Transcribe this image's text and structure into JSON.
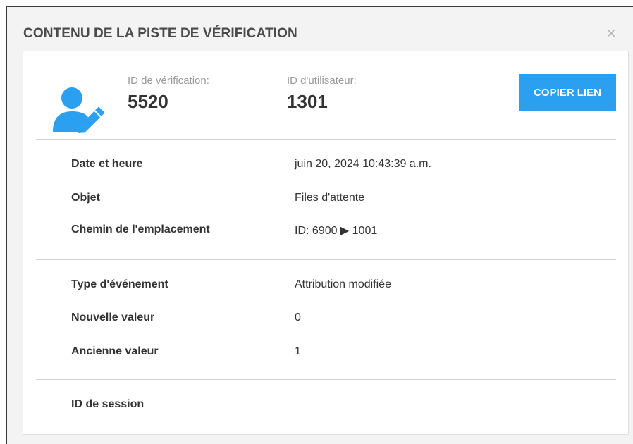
{
  "dialog": {
    "title": "CONTENU DE LA PISTE DE VÉRIFICATION",
    "close_glyph": "×"
  },
  "header": {
    "audit_id_label": "ID de vérification:",
    "audit_id_value": "5520",
    "user_id_label": "ID d'utilisateur:",
    "user_id_value": "1301",
    "copy_button_label": "COPIER LIEN",
    "icon": "user-edit-icon",
    "accent_color": "#2b9ff0"
  },
  "section1": {
    "date_label": "Date et heure",
    "date_value": "juin 20, 2024 10:43:39 a.m.",
    "object_label": "Objet",
    "object_value": "Files d'attente",
    "path_label": "Chemin de l'emplacement",
    "path_value": "ID: 6900 ▶ 1001"
  },
  "section2": {
    "event_type_label": "Type d'événement",
    "event_type_value": "Attribution modifiée",
    "new_value_label": "Nouvelle valeur",
    "new_value_value": "0",
    "old_value_label": "Ancienne valeur",
    "old_value_value": "1"
  },
  "section3": {
    "session_id_label": "ID de session"
  }
}
